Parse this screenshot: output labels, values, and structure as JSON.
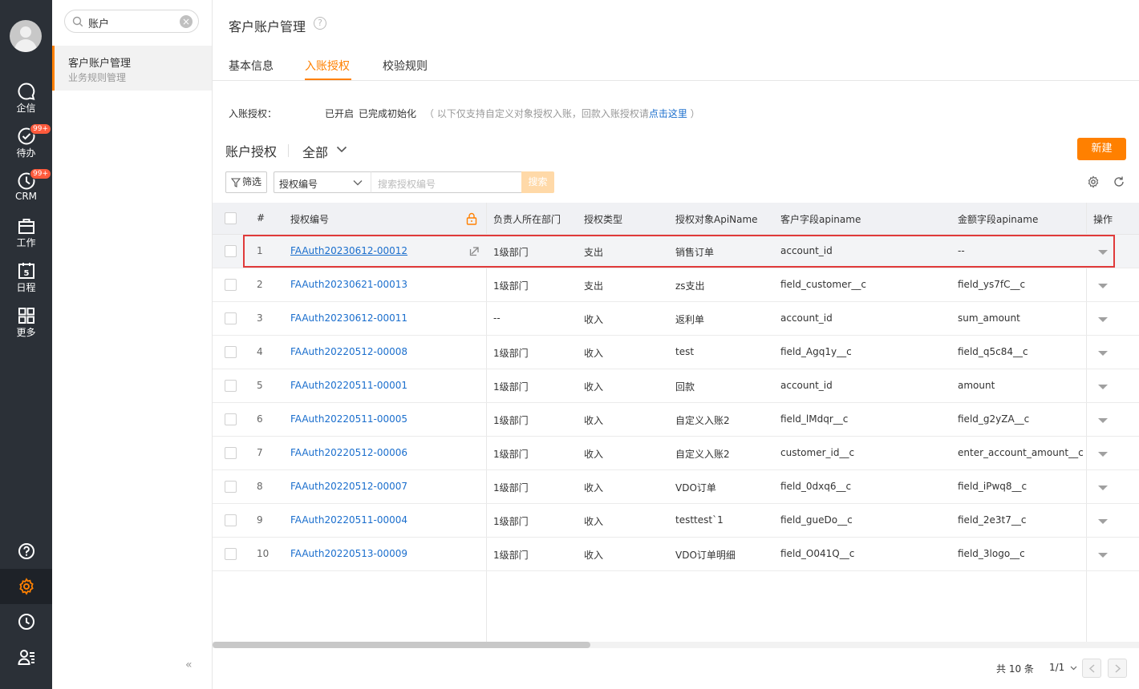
{
  "rail": {
    "items": [
      {
        "label": "企信",
        "icon": "chat-bubble-icon",
        "badge": ""
      },
      {
        "label": "待办",
        "icon": "todo-check-icon",
        "badge": "99+"
      },
      {
        "label": "CRM",
        "icon": "crm-clock-icon",
        "badge": "99+"
      },
      {
        "label": "工作",
        "icon": "briefcase-icon",
        "badge": ""
      },
      {
        "label": "日程",
        "icon": "calendar-icon",
        "badge": ""
      },
      {
        "label": "更多",
        "icon": "grid-icon",
        "badge": ""
      }
    ],
    "calendar_day": "5"
  },
  "subpanel": {
    "search_value": "账户",
    "menu_title": "客户账户管理",
    "menu_subtitle": "业务规则管理",
    "collapse_label": "«"
  },
  "header": {
    "title": "客户账户管理",
    "help_label": "?"
  },
  "tabs": [
    {
      "label": "基本信息",
      "active": false
    },
    {
      "label": "入账授权",
      "active": true
    },
    {
      "label": "校验规则",
      "active": false
    }
  ],
  "info": {
    "label": "入账授权：",
    "status": "已开启",
    "init_status": "已完成初始化",
    "note_prefix": "（ 以下仅支持自定义对象授权入账，回款入账授权请",
    "note_link": "点击这里",
    "note_suffix": "）"
  },
  "list": {
    "title": "账户授权",
    "scope": "全部",
    "new_button": "新建",
    "filter_button": "筛选",
    "field_select": "授权编号",
    "search_placeholder": "搜索授权编号",
    "search_button": "搜索"
  },
  "table": {
    "columns": [
      "#",
      "授权编号",
      "负责人所在部门",
      "授权类型",
      "授权对象ApiName",
      "客户字段apiname",
      "金额字段apiname",
      "操作"
    ],
    "rows": [
      {
        "idx": "1",
        "code": "FAAuth20230612-00012",
        "dept": "1级部门",
        "type": "支出",
        "object": "销售订单",
        "customer_field": "account_id",
        "amount_field": "--"
      },
      {
        "idx": "2",
        "code": "FAAuth20230621-00013",
        "dept": "1级部门",
        "type": "支出",
        "object": "zs支出",
        "customer_field": "field_customer__c",
        "amount_field": "field_ys7fC__c"
      },
      {
        "idx": "3",
        "code": "FAAuth20230612-00011",
        "dept": "--",
        "type": "收入",
        "object": "返利单",
        "customer_field": "account_id",
        "amount_field": "sum_amount"
      },
      {
        "idx": "4",
        "code": "FAAuth20220512-00008",
        "dept": "1级部门",
        "type": "收入",
        "object": "test",
        "customer_field": "field_Agq1y__c",
        "amount_field": "field_q5c84__c"
      },
      {
        "idx": "5",
        "code": "FAAuth20220511-00001",
        "dept": "1级部门",
        "type": "收入",
        "object": "回款",
        "customer_field": "account_id",
        "amount_field": "amount"
      },
      {
        "idx": "6",
        "code": "FAAuth20220511-00005",
        "dept": "1级部门",
        "type": "收入",
        "object": "自定义入账2",
        "customer_field": "field_lMdqr__c",
        "amount_field": "field_g2yZA__c"
      },
      {
        "idx": "7",
        "code": "FAAuth20220512-00006",
        "dept": "1级部门",
        "type": "收入",
        "object": "自定义入账2",
        "customer_field": "customer_id__c",
        "amount_field": "enter_account_amount__c"
      },
      {
        "idx": "8",
        "code": "FAAuth20220512-00007",
        "dept": "1级部门",
        "type": "收入",
        "object": "VDO订单",
        "customer_field": "field_0dxq6__c",
        "amount_field": "field_iPwq8__c"
      },
      {
        "idx": "9",
        "code": "FAAuth20220511-00004",
        "dept": "1级部门",
        "type": "收入",
        "object": "testtest`1",
        "customer_field": "field_gueDo__c",
        "amount_field": "field_2e3t7__c"
      },
      {
        "idx": "10",
        "code": "FAAuth20220513-00009",
        "dept": "1级部门",
        "type": "收入",
        "object": "VDO订单明细",
        "customer_field": "field_O041Q__c",
        "amount_field": "field_3logo__c"
      }
    ]
  },
  "pager": {
    "total": "共 10 条",
    "page": "1/1"
  },
  "colors": {
    "accent": "#ff8000",
    "link": "#1a6ecd",
    "rail_bg": "#2b3037",
    "highlight": "#e03a3a"
  }
}
